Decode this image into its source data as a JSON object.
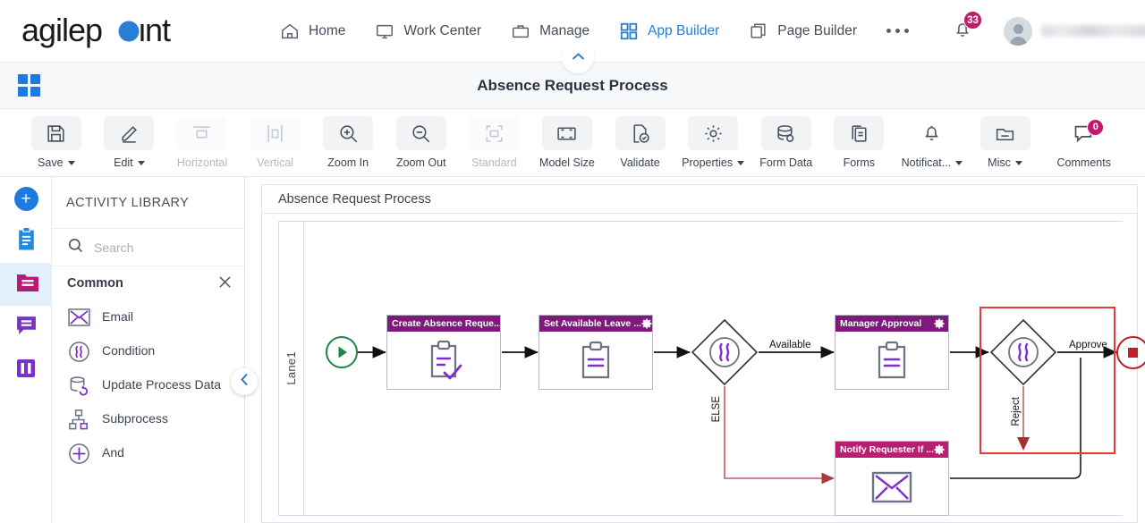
{
  "topnav": {
    "brand": "agilepoint",
    "items": [
      {
        "label": "Home",
        "icon": "home-icon",
        "active": false
      },
      {
        "label": "Work Center",
        "icon": "monitor-icon",
        "active": false
      },
      {
        "label": "Manage",
        "icon": "briefcase-icon",
        "active": false
      },
      {
        "label": "App Builder",
        "icon": "grid-icon",
        "active": true
      },
      {
        "label": "Page Builder",
        "icon": "copy-icon",
        "active": false
      }
    ],
    "more_label": "More",
    "notification_count": "33",
    "username": ""
  },
  "titlebar": {
    "app_title": "Absence Request Process",
    "grid_icon": "apps-grid-icon",
    "collapse_icon": "chevron-up-icon"
  },
  "toolbar": {
    "buttons": [
      {
        "label": "Save",
        "icon": "save-icon",
        "caret": true,
        "disabled": false
      },
      {
        "label": "Edit",
        "icon": "pencil-icon",
        "caret": true,
        "disabled": false
      },
      {
        "label": "Horizontal",
        "icon": "horizontal-icon",
        "caret": false,
        "disabled": true
      },
      {
        "label": "Vertical",
        "icon": "vertical-icon",
        "caret": false,
        "disabled": true
      },
      {
        "label": "Zoom In",
        "icon": "zoom-in-icon",
        "caret": false,
        "disabled": false
      },
      {
        "label": "Zoom Out",
        "icon": "zoom-out-icon",
        "caret": false,
        "disabled": false
      },
      {
        "label": "Standard",
        "icon": "standard-icon",
        "caret": false,
        "disabled": true
      },
      {
        "label": "Model Size",
        "icon": "model-size-icon",
        "caret": false,
        "disabled": false
      },
      {
        "label": "Validate",
        "icon": "validate-icon",
        "caret": false,
        "disabled": false
      },
      {
        "label": "Properties",
        "icon": "gear-icon",
        "caret": true,
        "disabled": false
      },
      {
        "label": "Form Data",
        "icon": "database-icon",
        "caret": false,
        "disabled": false
      },
      {
        "label": "Forms",
        "icon": "forms-icon",
        "caret": false,
        "disabled": false
      },
      {
        "label": "Notificat...",
        "icon": "bell-icon",
        "caret": true,
        "disabled": false
      },
      {
        "label": "Misc",
        "icon": "folder-icon",
        "caret": true,
        "disabled": false
      },
      {
        "label": "Comments",
        "icon": "comment-icon",
        "caret": false,
        "disabled": false,
        "badge": "0"
      }
    ]
  },
  "rail": {
    "items": [
      {
        "icon": "plus-circle-icon",
        "name": "add-activity",
        "selected": false
      },
      {
        "icon": "clipboard-icon",
        "name": "tasks",
        "selected": false
      },
      {
        "icon": "folder-lib-icon",
        "name": "activity-library",
        "selected": true
      },
      {
        "icon": "chat-icon",
        "name": "comments",
        "selected": false
      },
      {
        "icon": "columns-icon",
        "name": "swimlanes",
        "selected": false
      }
    ]
  },
  "library": {
    "title": "ACTIVITY LIBRARY",
    "search": {
      "placeholder": "Search",
      "value": "",
      "icon": "search-icon"
    },
    "group": {
      "label": "Common",
      "close_icon": "close-icon"
    },
    "items": [
      {
        "label": "Email",
        "icon": "envelope-icon"
      },
      {
        "label": "Condition",
        "icon": "condition-icon"
      },
      {
        "label": "Update Process Data",
        "icon": "update-data-icon"
      },
      {
        "label": "Subprocess",
        "icon": "subprocess-icon"
      },
      {
        "label": "And",
        "icon": "and-icon"
      }
    ],
    "panel_toggle_icon": "chevron-left-icon"
  },
  "canvas": {
    "header": "Absence Request Process",
    "lane": "Lane1",
    "nodes": [
      {
        "id": "start",
        "type": "start-event",
        "label": ""
      },
      {
        "id": "create",
        "type": "activity",
        "label": "Create Absence Reque...",
        "accent": "purple"
      },
      {
        "id": "setleave",
        "type": "activity",
        "label": "Set Available Leave ...",
        "accent": "purple"
      },
      {
        "id": "cond1",
        "type": "gateway",
        "label": ""
      },
      {
        "id": "approval",
        "type": "activity",
        "label": "Manager Approval",
        "accent": "purple"
      },
      {
        "id": "cond2",
        "type": "gateway",
        "label": "",
        "selected": true
      },
      {
        "id": "notify",
        "type": "activity",
        "label": "Notify Requester If ...",
        "accent": "pink"
      },
      {
        "id": "end",
        "type": "end-event",
        "label": ""
      }
    ],
    "edge_labels": {
      "available": "Available",
      "else": "ELSE",
      "approve": "Approve",
      "reject": "Reject"
    },
    "colors": {
      "activity_header_purple": "#7d1a7b",
      "activity_header_pink": "#b81e72",
      "start_event": "#1e8449",
      "end_event": "#c02026",
      "selection": "#e8393a",
      "reject_path": "#c0504d",
      "accent_blue": "#1f7ae0"
    }
  }
}
